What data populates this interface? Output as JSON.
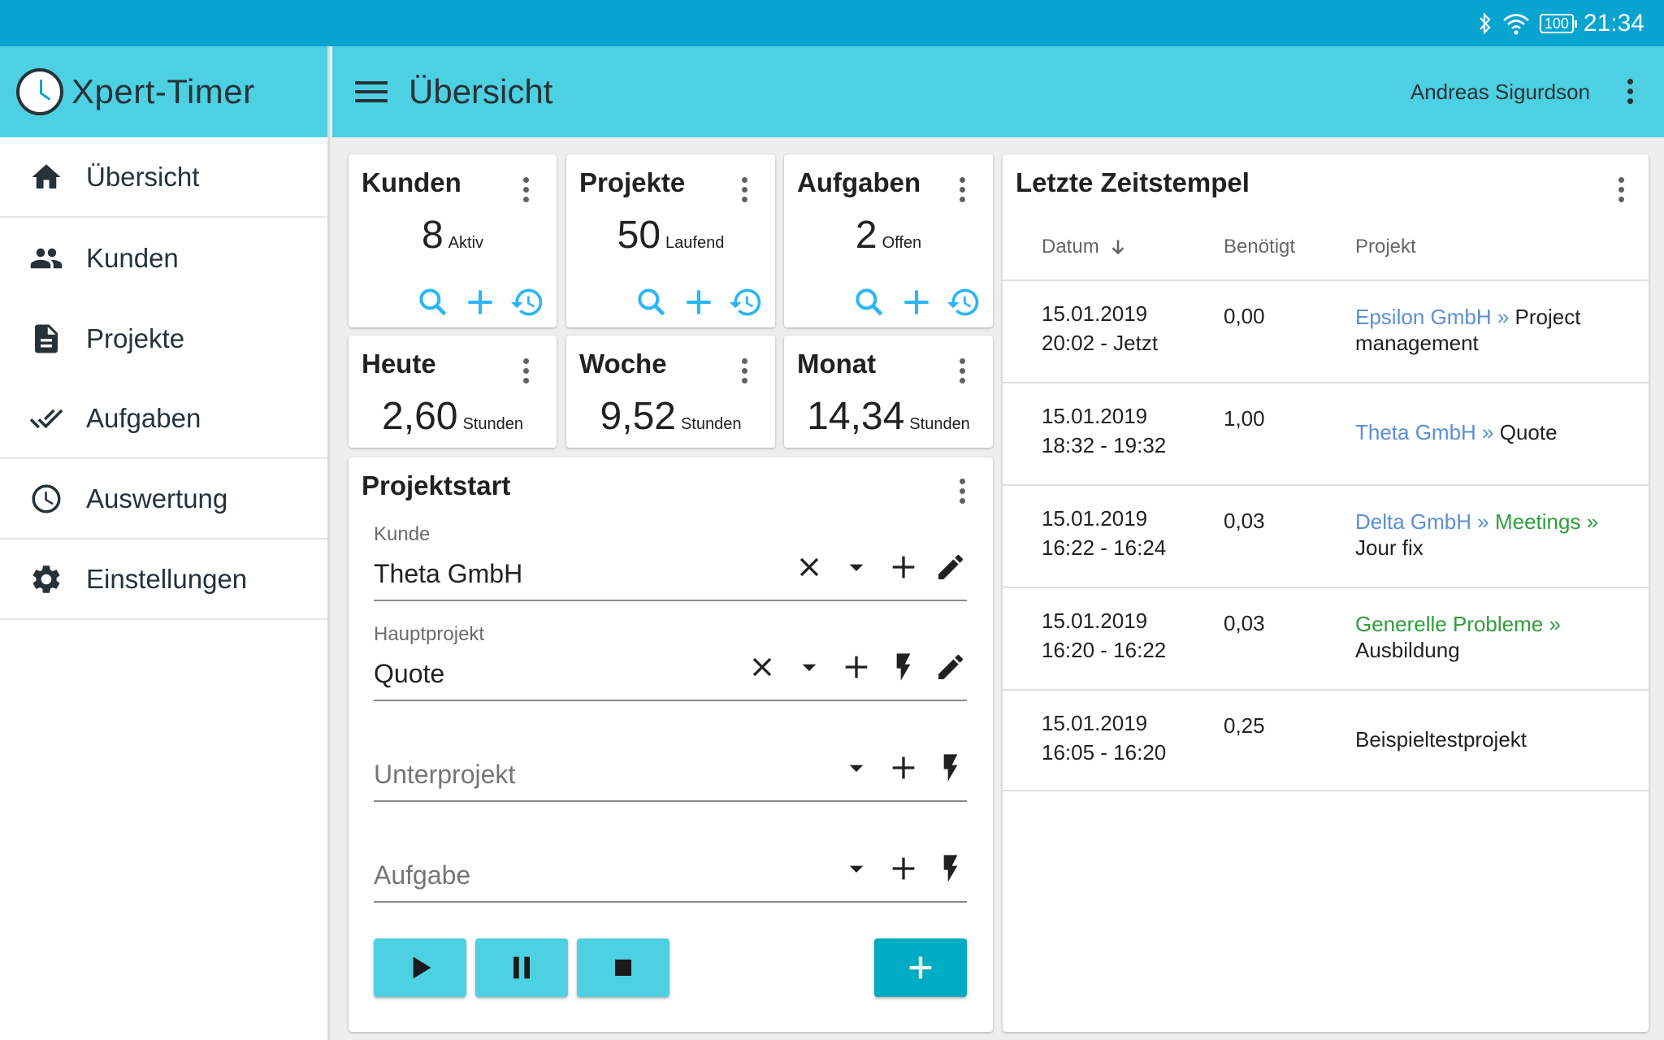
{
  "status_bar": {
    "time": "21:34",
    "battery": "100",
    "icons": [
      "bluetooth-icon",
      "wifi-icon",
      "battery-icon"
    ]
  },
  "sidebar": {
    "app_title": "Xpert-Timer",
    "items": [
      {
        "label": "Übersicht",
        "icon": "home-icon"
      },
      {
        "label": "Kunden",
        "icon": "people-icon"
      },
      {
        "label": "Projekte",
        "icon": "document-icon"
      },
      {
        "label": "Aufgaben",
        "icon": "double-check-icon"
      },
      {
        "label": "Auswertung",
        "icon": "clock-icon"
      },
      {
        "label": "Einstellungen",
        "icon": "gear-icon"
      }
    ]
  },
  "appbar": {
    "title": "Übersicht",
    "user": "Andreas Sigurdson"
  },
  "summary_cards": [
    {
      "title": "Kunden",
      "value": "8",
      "unit": "Aktiv"
    },
    {
      "title": "Projekte",
      "value": "50",
      "unit": "Laufend"
    },
    {
      "title": "Aufgaben",
      "value": "2",
      "unit": "Offen"
    }
  ],
  "time_cards": [
    {
      "title": "Heute",
      "value": "2,60",
      "unit": "Stunden"
    },
    {
      "title": "Woche",
      "value": "9,52",
      "unit": "Stunden"
    },
    {
      "title": "Monat",
      "value": "14,34",
      "unit": "Stunden"
    }
  ],
  "projektstart": {
    "title": "Projektstart",
    "kunde": {
      "label": "Kunde",
      "value": "Theta GmbH"
    },
    "hauptprojekt": {
      "label": "Hauptprojekt",
      "value": "Quote"
    },
    "unterprojekt": {
      "placeholder": "Unterprojekt"
    },
    "aufgabe": {
      "placeholder": "Aufgabe"
    }
  },
  "timestamps": {
    "title": "Letzte Zeitstempel",
    "columns": {
      "datum": "Datum",
      "benoetigt": "Benötigt",
      "projekt": "Projekt"
    },
    "rows": [
      {
        "date": "15.01.2019",
        "time": "20:02 - Jetzt",
        "duration": "0,00",
        "customer": "Epsilon GmbH »",
        "sub": "",
        "project": "Project management"
      },
      {
        "date": "15.01.2019",
        "time": "18:32 - 19:32",
        "duration": "1,00",
        "customer": "Theta GmbH »",
        "sub": "",
        "project": "Quote"
      },
      {
        "date": "15.01.2019",
        "time": "16:22 - 16:24",
        "duration": "0,03",
        "customer": "Delta GmbH »",
        "sub": "Meetings »",
        "project": "Jour fix"
      },
      {
        "date": "15.01.2019",
        "time": "16:20 - 16:22",
        "duration": "0,03",
        "customer": "",
        "sub": "Generelle Probleme »",
        "project": "Ausbildung"
      },
      {
        "date": "15.01.2019",
        "time": "16:05 - 16:20",
        "duration": "0,25",
        "customer": "",
        "sub": "",
        "project": "Beispieltestprojekt"
      }
    ]
  },
  "colors": {
    "status_bar": "#07a4d0",
    "app_bar": "#4dd0e1",
    "accent_icon": "#29b6f6",
    "add_button": "#00acc1",
    "customer_link": "#5a8fd6",
    "subproject_link": "#2e9d3b"
  }
}
